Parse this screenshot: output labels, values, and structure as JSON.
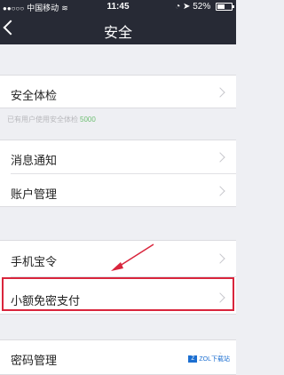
{
  "status_bar": {
    "signal": "●●○○○",
    "carrier": "中国移动",
    "time": "11:45",
    "battery_percent": "52%",
    "battery_level": 0.52
  },
  "nav": {
    "title": "安全"
  },
  "rows": {
    "security_check": "安全体检",
    "notifications": "消息通知",
    "account_management": "账户管理",
    "phone_token": "手机宝令",
    "small_password_free_pay": "小额免密支付",
    "password_management": "密码管理"
  },
  "hint": {
    "text": "已有用户使用安全体检",
    "score": "5000"
  },
  "watermark": {
    "text": "ZOL下载站"
  },
  "colors": {
    "nav_bg": "#272a35",
    "highlight": "#d9253c",
    "page_bg": "#eeeff3"
  }
}
